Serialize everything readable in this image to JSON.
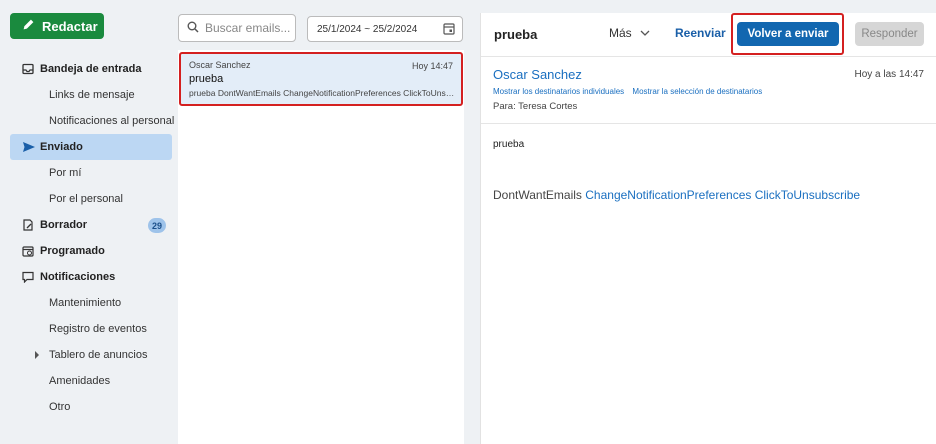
{
  "compose": {
    "label": "Redactar"
  },
  "sidebar": {
    "items": [
      {
        "label": "Bandeja de entrada",
        "level": "top",
        "icon": "inbox-icon"
      },
      {
        "label": "Links de mensaje",
        "level": "sub"
      },
      {
        "label": "Notificaciones al personal",
        "level": "sub"
      },
      {
        "label": "Enviado",
        "level": "top",
        "icon": "send-icon",
        "active": true
      },
      {
        "label": "Por mí",
        "level": "sub"
      },
      {
        "label": "Por el personal",
        "level": "sub"
      },
      {
        "label": "Borrador",
        "level": "top",
        "icon": "draft-icon",
        "badge": "29"
      },
      {
        "label": "Programado",
        "level": "top",
        "icon": "scheduled-icon"
      },
      {
        "label": "Notificaciones",
        "level": "top",
        "icon": "notification-icon"
      },
      {
        "label": "Mantenimiento",
        "level": "sub"
      },
      {
        "label": "Registro de eventos",
        "level": "sub"
      },
      {
        "label": "Tablero de anuncios",
        "level": "sub",
        "expandable": true
      },
      {
        "label": "Amenidades",
        "level": "sub"
      },
      {
        "label": "Otro",
        "level": "sub"
      }
    ]
  },
  "list": {
    "search_placeholder": "Buscar emails...",
    "date_range": "25/1/2024 ~ 25/2/2024",
    "emails": [
      {
        "sender": "Oscar Sanchez",
        "time": "Hoy 14:47",
        "subject": "prueba",
        "preview": "prueba DontWantEmails ChangeNotificationPreferences ClickToUnsubscribe"
      }
    ]
  },
  "pane": {
    "title": "prueba",
    "more_label": "Más",
    "forward_label": "Reenviar",
    "resend_label": "Volver a enviar",
    "reply_label": "Responder",
    "from_name": "Oscar Sanchez",
    "from_time": "Hoy a las 14:47",
    "show_individual": "Mostrar los destinatarios individuales",
    "show_selection": "Mostrar la selección de destinatarios",
    "to": "Para: Teresa Cortes",
    "body_first": "prueba",
    "body_plain": "DontWantEmails",
    "body_link1": "ChangeNotificationPreferences",
    "body_link2": "ClickToUnsubscribe"
  },
  "colors": {
    "compose": "#1a8a3e",
    "primary": "#1267b0",
    "link": "#1a6fc0",
    "highlight": "#d42020",
    "active_nav": "#bcd7f3"
  }
}
